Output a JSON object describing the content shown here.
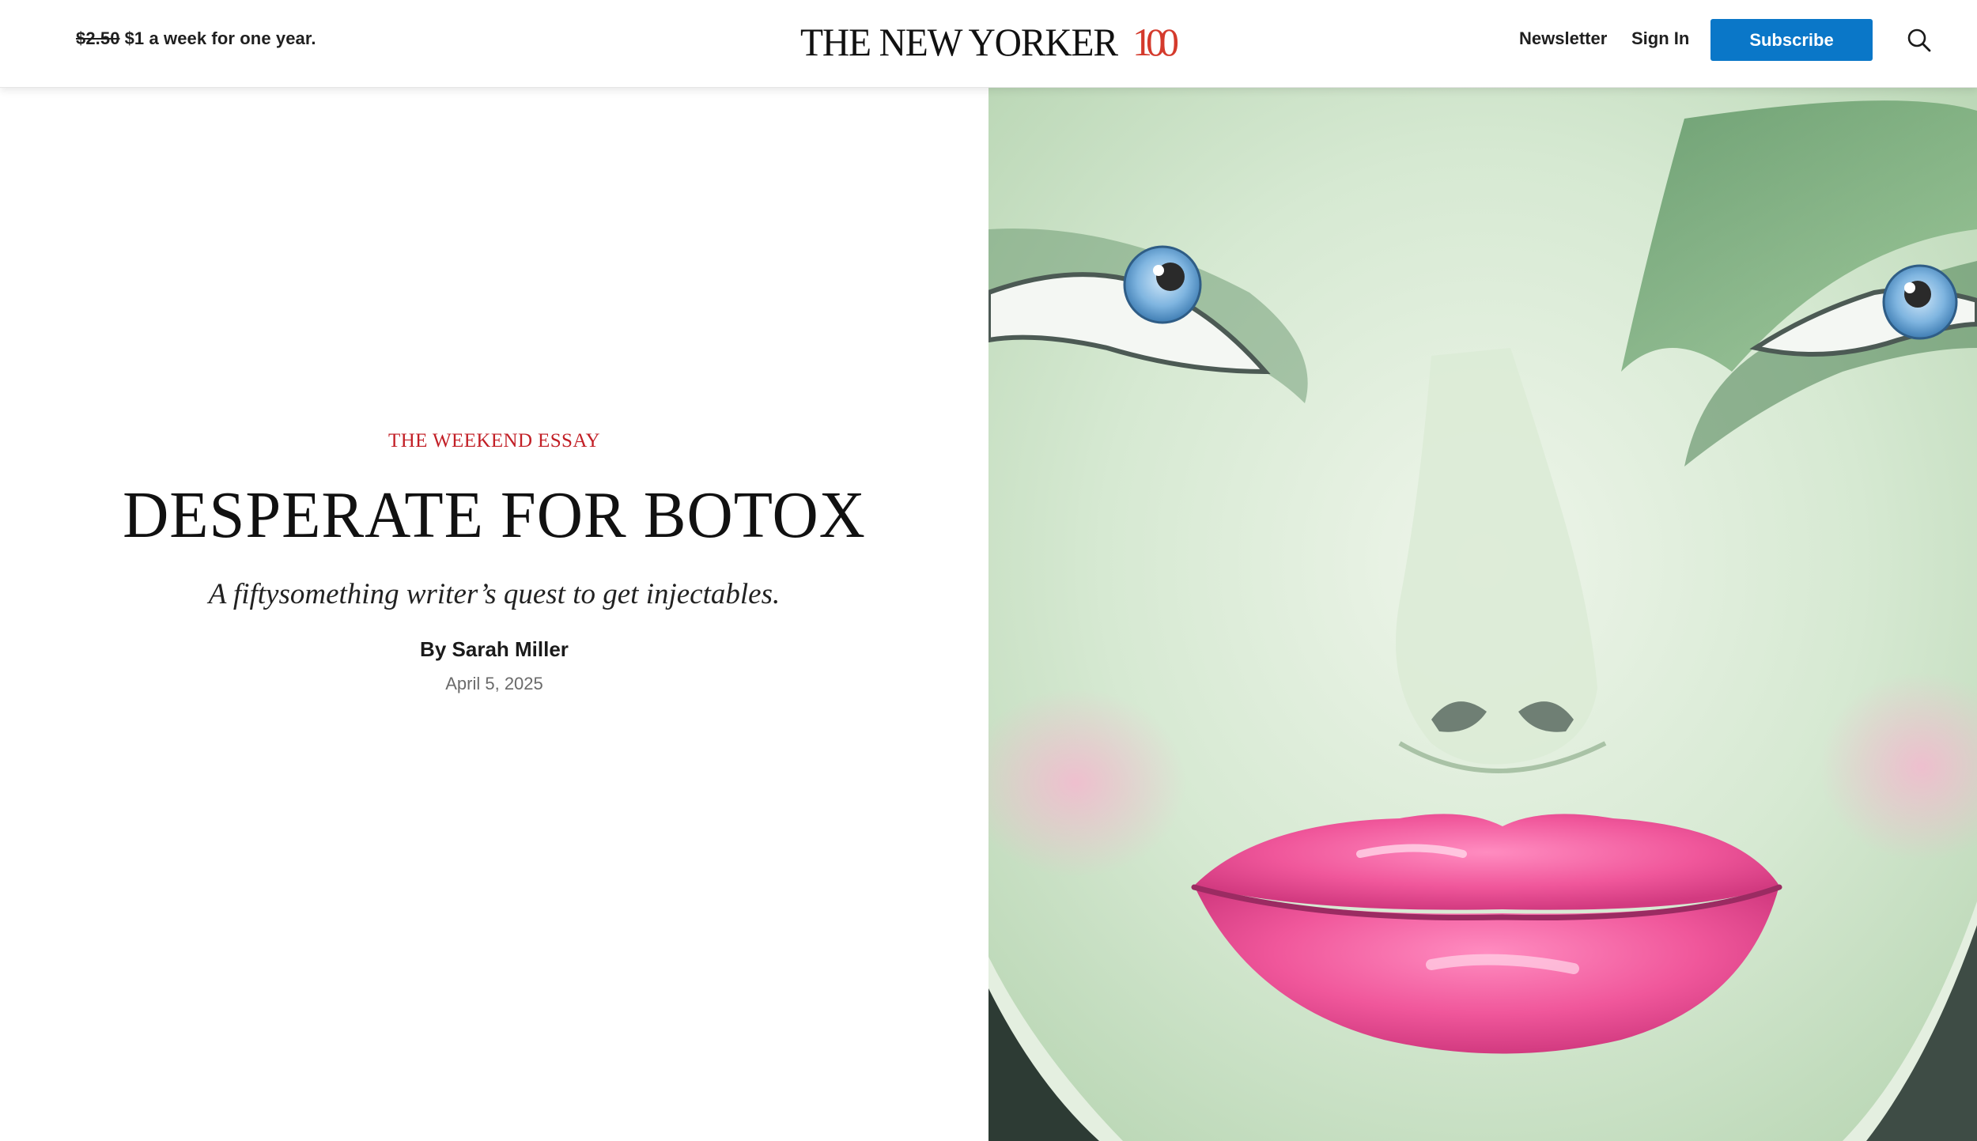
{
  "header": {
    "promo": {
      "old_price": "$2.50",
      "offer": "$1 a week for one year."
    },
    "logo": {
      "wordmark": "THE NEW YORKER",
      "anniversary": "100"
    },
    "nav": {
      "newsletter": "Newsletter",
      "sign_in": "Sign In",
      "subscribe": "Subscribe"
    },
    "icons": {
      "search": "search-icon"
    }
  },
  "article": {
    "rubric": "THE WEEKEND ESSAY",
    "headline": "DESPERATE FOR BOTOX",
    "dek": "A fiftysomething writer’s quest to get injectables.",
    "byline_prefix": "By",
    "author": "Sarah Miller",
    "date": "April 5, 2025"
  },
  "colors": {
    "accent": "#0a77c8",
    "rubric": "#c21f26",
    "logo_hundred": "#d43a2c",
    "lips": "#f0579b",
    "skin": "#d9ecd6"
  }
}
